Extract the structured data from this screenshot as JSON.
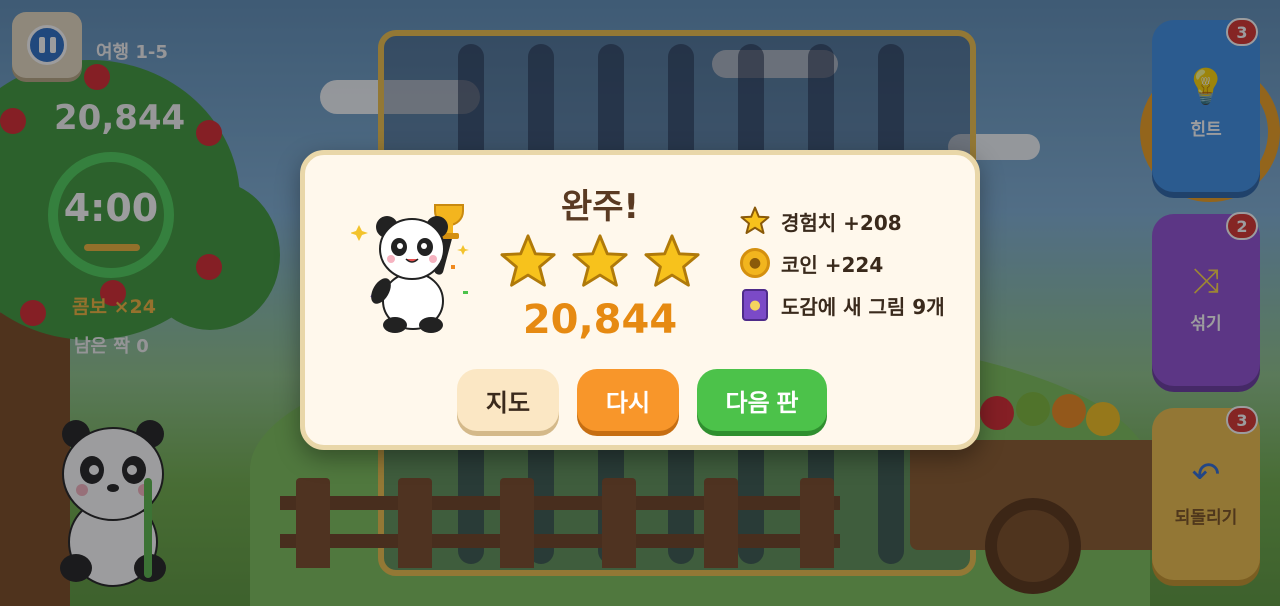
{
  "hud": {
    "level_label": "여행 1-5",
    "score": "20,844",
    "timer": "4:00",
    "combo": "콤보 ×24",
    "remaining_pairs": "남은 짝 0"
  },
  "powerups": {
    "hint": {
      "label": "힌트",
      "count": "3",
      "icon": "lightbulb-icon"
    },
    "shuffle": {
      "label": "섞기",
      "count": "2",
      "icon": "shuffle-icon"
    },
    "undo": {
      "label": "되돌리기",
      "count": "3",
      "icon": "undo-icon"
    }
  },
  "dialog": {
    "title": "완주!",
    "stars_earned": 3,
    "stars_total": 3,
    "score": "20,844",
    "rewards": [
      {
        "icon": "star-icon",
        "text": "경험치 +208"
      },
      {
        "icon": "coin-icon",
        "text": "코인 +224"
      },
      {
        "icon": "album-book-icon",
        "text": "도감에 새 그림 9개"
      }
    ],
    "buttons": {
      "map": "지도",
      "retry": "다시",
      "next": "다음 판"
    }
  },
  "colors": {
    "star": "#f7c21c",
    "score_orange": "#e68a12",
    "retry_button": "#f8962a",
    "next_button": "#4cc24a",
    "map_button": "#fbe7c4"
  }
}
